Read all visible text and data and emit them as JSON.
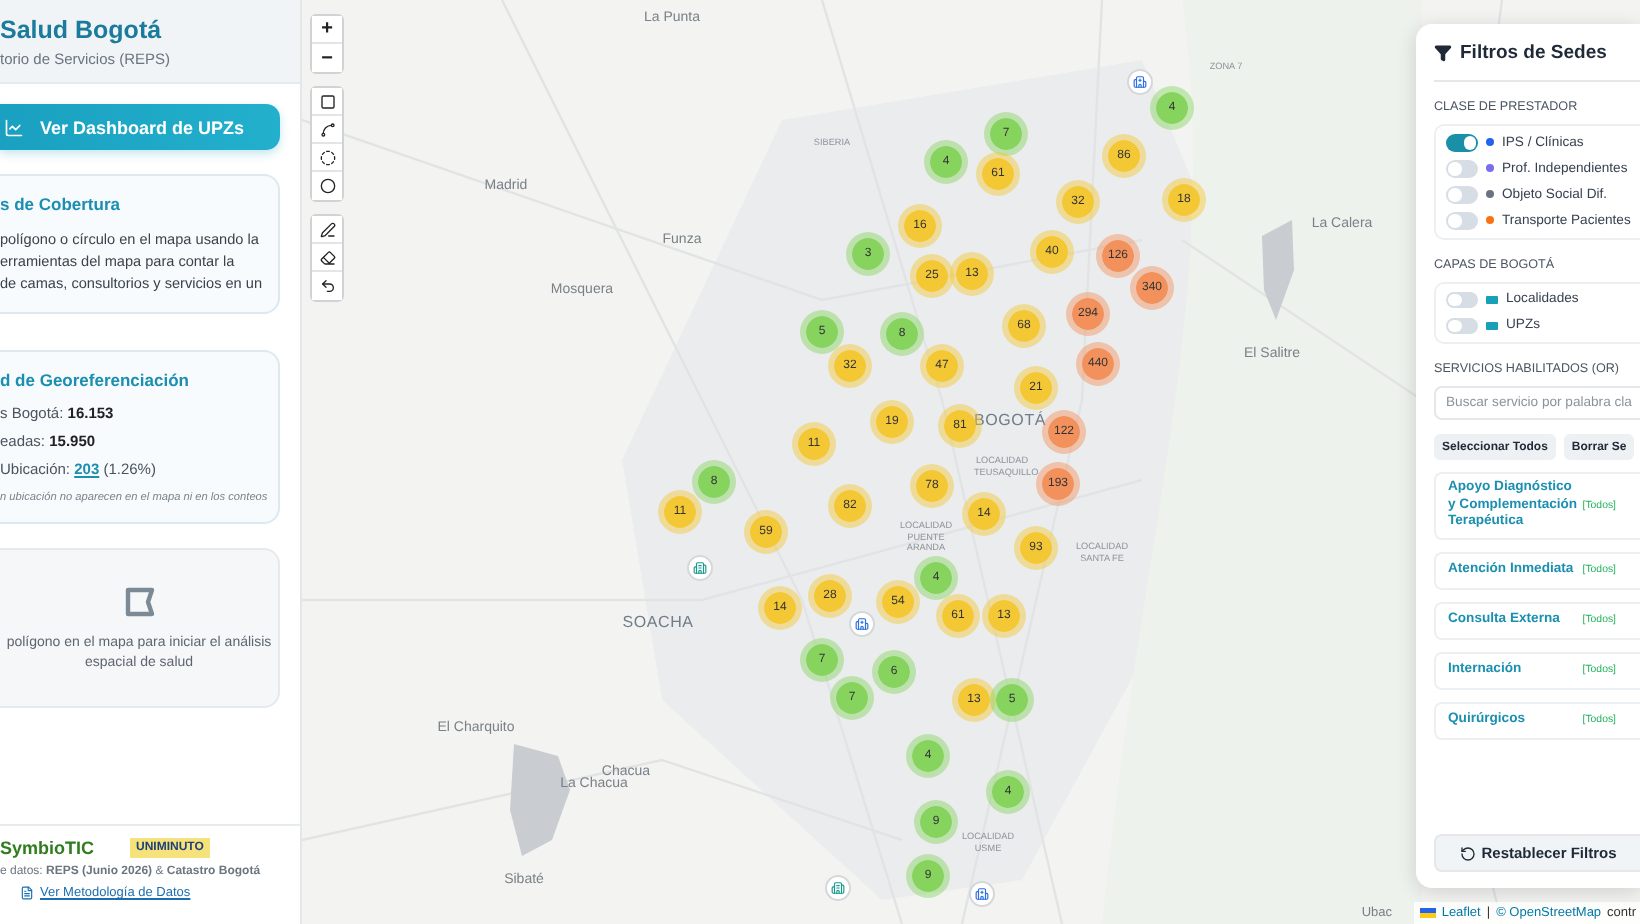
{
  "sidebar": {
    "title": "Salud Bogotá",
    "subtitle": "torio de Servicios (REPS)",
    "dashboard_button": "Ver Dashboard de UPZs",
    "coverage_card": {
      "title": "s de Cobertura",
      "lines": [
        "polígono o círculo en el mapa usando la",
        "erramientas del mapa para contar la",
        "de camas, consultorios y servicios en un"
      ]
    },
    "georef_card": {
      "title": "d de Georeferenciación",
      "rows": [
        {
          "label": "s Bogotá: ",
          "value": "16.153"
        },
        {
          "label": "eadas: ",
          "value": "15.950"
        }
      ],
      "missing": {
        "label": "Ubicación: ",
        "link": "203",
        "after": " (1.26%)"
      },
      "note": "n ubicación no aparecen en el mapa ni en los conteos"
    },
    "empty_state": {
      "lines": [
        "polígono en el mapa para iniciar el análisis",
        "espacial de salud"
      ]
    },
    "footer": {
      "logos": [
        {
          "text": "SymbioTIC",
          "kind": "symbiotic"
        },
        {
          "text": "UNIMINUTO",
          "kind": "uniminuto"
        }
      ],
      "source": "e datos: **REPS (Junio 2026)** & **Catastro Bogotá**",
      "methodology_link": "Ver Metodología de Datos"
    }
  },
  "map": {
    "zoom_controls": [
      "+",
      "−"
    ],
    "labels": [
      {
        "text": "La Punta",
        "kind": "town"
      },
      {
        "text": "ZONA 7",
        "kind": "locality"
      },
      {
        "text": "SIBERIA",
        "kind": "locality"
      },
      {
        "text": "Madrid",
        "kind": "town"
      },
      {
        "text": "La Calera",
        "kind": "town"
      },
      {
        "text": "Funza",
        "kind": "town"
      },
      {
        "text": "Mosquera",
        "kind": "town"
      },
      {
        "text": "El Salitre",
        "kind": "town"
      },
      {
        "text": "BOGOTÁ",
        "kind": "city"
      },
      {
        "text": "LOCALIDAD TEUSAQUILLO",
        "kind": "locality"
      },
      {
        "text": "LOCALIDAD PUENTE ARANDA",
        "kind": "locality"
      },
      {
        "text": "LOCALIDAD SANTA FE",
        "kind": "locality"
      },
      {
        "text": "SOACHA",
        "kind": "city"
      },
      {
        "text": "El Charquito",
        "kind": "town"
      },
      {
        "text": "Chacua",
        "kind": "town"
      },
      {
        "text": "La Chacua",
        "kind": "town"
      },
      {
        "text": "LOCALIDAD USME",
        "kind": "locality"
      },
      {
        "text": "Sibaté",
        "kind": "town"
      }
    ],
    "clusters": [
      {
        "count": "7",
        "kind": "small"
      },
      {
        "count": "4",
        "kind": "small"
      },
      {
        "count": "61",
        "kind": "medium"
      },
      {
        "count": "4",
        "kind": "small"
      },
      {
        "count": "86",
        "kind": "medium"
      },
      {
        "count": "18",
        "kind": "medium"
      },
      {
        "count": "32",
        "kind": "medium"
      },
      {
        "count": "16",
        "kind": "medium"
      },
      {
        "count": "3",
        "kind": "small"
      },
      {
        "count": "25",
        "kind": "medium"
      },
      {
        "count": "13",
        "kind": "medium"
      },
      {
        "count": "40",
        "kind": "medium"
      },
      {
        "count": "126",
        "kind": "large"
      },
      {
        "count": "340",
        "kind": "large"
      },
      {
        "count": "294",
        "kind": "large"
      },
      {
        "count": "68",
        "kind": "medium"
      },
      {
        "count": "5",
        "kind": "small"
      },
      {
        "count": "8",
        "kind": "small"
      },
      {
        "count": "32",
        "kind": "medium"
      },
      {
        "count": "47",
        "kind": "medium"
      },
      {
        "count": "440",
        "kind": "large"
      },
      {
        "count": "21",
        "kind": "medium"
      },
      {
        "count": "19",
        "kind": "medium"
      },
      {
        "count": "81",
        "kind": "medium"
      },
      {
        "count": "122",
        "kind": "large"
      },
      {
        "count": "11",
        "kind": "medium"
      },
      {
        "count": "8",
        "kind": "small"
      },
      {
        "count": "78",
        "kind": "medium"
      },
      {
        "count": "193",
        "kind": "large"
      },
      {
        "count": "11",
        "kind": "medium"
      },
      {
        "count": "82",
        "kind": "medium"
      },
      {
        "count": "14",
        "kind": "medium"
      },
      {
        "count": "59",
        "kind": "medium"
      },
      {
        "count": "93",
        "kind": "medium"
      },
      {
        "count": "4",
        "kind": "small"
      },
      {
        "count": "28",
        "kind": "medium"
      },
      {
        "count": "14",
        "kind": "medium"
      },
      {
        "count": "54",
        "kind": "medium"
      },
      {
        "count": "61",
        "kind": "medium"
      },
      {
        "count": "13",
        "kind": "medium"
      },
      {
        "count": "7",
        "kind": "small"
      },
      {
        "count": "6",
        "kind": "small"
      },
      {
        "count": "7",
        "kind": "small"
      },
      {
        "count": "13",
        "kind": "medium"
      },
      {
        "count": "5",
        "kind": "small"
      },
      {
        "count": "4",
        "kind": "small"
      },
      {
        "count": "4",
        "kind": "small"
      },
      {
        "count": "9",
        "kind": "small"
      },
      {
        "count": "9",
        "kind": "small"
      }
    ],
    "markers": [
      {
        "kind": "ips"
      },
      {
        "kind": "transport"
      },
      {
        "kind": "ips"
      },
      {
        "kind": "transport"
      },
      {
        "kind": "ips"
      }
    ],
    "covered_label": "Ubac",
    "attribution": {
      "leaflet": "Leaflet",
      "separator": "|",
      "osm": "© OpenStreetMap",
      "tail": "contr"
    }
  },
  "filters": {
    "title": "Filtros de Sedes",
    "provider_label": "CLASE DE PRESTADOR",
    "providers": [
      {
        "label": "IPS / Clínicas",
        "on": true,
        "color": "#2563eb"
      },
      {
        "label": "Prof. Independientes",
        "on": false,
        "color": "#7c6cf0"
      },
      {
        "label": "Objeto Social Dif.",
        "on": false,
        "color": "#6b7280"
      },
      {
        "label": "Transporte Pacientes",
        "on": false,
        "color": "#f97316"
      }
    ],
    "layers_label": "CAPAS DE BOGOTÁ",
    "layers": [
      {
        "label": "Localidades",
        "on": false
      },
      {
        "label": "UPZs",
        "on": false
      }
    ],
    "services_label": "SERVICIOS HABILITADOS (OR)",
    "search": {
      "placeholder": "Buscar servicio por palabra cla"
    },
    "buttons": [
      "Seleccionar Todos",
      "Borrar Se"
    ],
    "groups": [
      {
        "name": "Apoyo Diagnóstico y Complementación Terapéutica",
        "badge": "[Todos]"
      },
      {
        "name": "Atención Inmediata",
        "badge": "[Todos]"
      },
      {
        "name": "Consulta Externa",
        "badge": "[Todos]"
      },
      {
        "name": "Internación",
        "badge": "[Todos]"
      },
      {
        "name": "Quirúrgicos",
        "badge": "[Todos]"
      }
    ],
    "reset_button": "Restablecer Filtros"
  }
}
